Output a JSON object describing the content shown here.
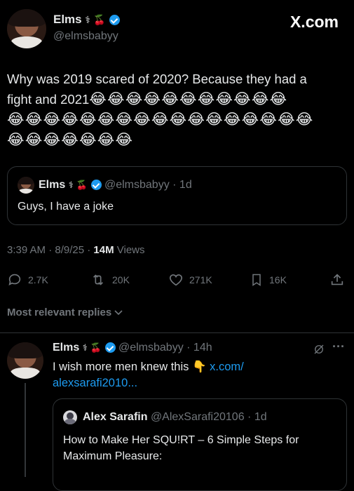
{
  "header": {
    "display_name": "Elms",
    "name_emoji": "⚕ 🍒",
    "handle": "@elmsbabyy",
    "site_logo": "X.com"
  },
  "tweet": {
    "text_line1": "Why was 2019 scared of 2020? Because they had a",
    "text_line2": "fight and 2021",
    "emoji_row1": "😂😂😂😂😂😂😂😂😂😂😂",
    "emoji_row2": "😂😂😂😂😂😂😂😂😂😂😂😂😂😂😂😂😂",
    "emoji_row3": "😂😂😂😂😂😂😂"
  },
  "quoted": {
    "display_name": "Elms",
    "name_emoji": "⚕ 🍒",
    "handle": "@elmsbabyy",
    "age": "· 1d",
    "text": "Guys, I have a joke"
  },
  "meta": {
    "time_date": "3:39 AM · 8/9/25 ·",
    "views_count": "14M",
    "views_label": "Views"
  },
  "actions": {
    "replies": "2.7K",
    "reposts": "20K",
    "likes": "271K",
    "bookmarks": "16K"
  },
  "replies_filter": {
    "label": "Most relevant replies"
  },
  "reply": {
    "display_name": "Elms",
    "name_emoji": "⚕ 🍒",
    "handle": "@elmsbabyy",
    "age": "· 14h",
    "more": "···",
    "text": "I wish more men knew this 👇",
    "link_part1": "x.com/",
    "link_part2": "alexsarafi2010..."
  },
  "reply_quote": {
    "display_name": "Alex Sarafin",
    "handle": "@AlexSarafi20106",
    "age": "· 1d",
    "text_line1": "How to Make Her SQU!RT – 6 Simple Steps for",
    "text_line2": "Maximum Pleasure:"
  },
  "icons": {
    "reply": "reply-icon",
    "repost": "repost-icon",
    "like": "heart-icon",
    "bookmark": "bookmark-icon",
    "share": "share-icon",
    "chevron": "chevron-down-icon",
    "grok": "grok-icon"
  }
}
